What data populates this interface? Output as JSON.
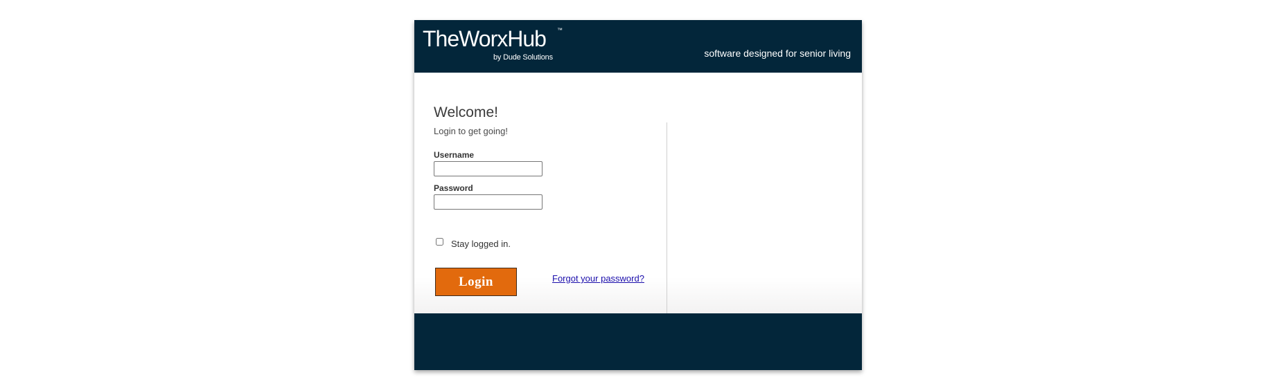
{
  "header": {
    "logo_text": "TheWorxHub",
    "logo_trademark": "™",
    "logo_byline": "by Dude Solutions",
    "tagline": "software designed for senior living"
  },
  "login": {
    "welcome": "Welcome!",
    "subtitle": "Login to get going!",
    "username_label": "Username",
    "username_value": "",
    "password_label": "Password",
    "password_value": "",
    "stay_logged_in_label": "Stay logged in.",
    "stay_logged_in_checked": false,
    "login_button_label": "Login",
    "forgot_password_link": "Forgot your password?"
  },
  "colors": {
    "header_bg": "#03263a",
    "footer_bg": "#03263a",
    "login_button_bg": "#e26a0d",
    "link": "#1a0dab"
  }
}
